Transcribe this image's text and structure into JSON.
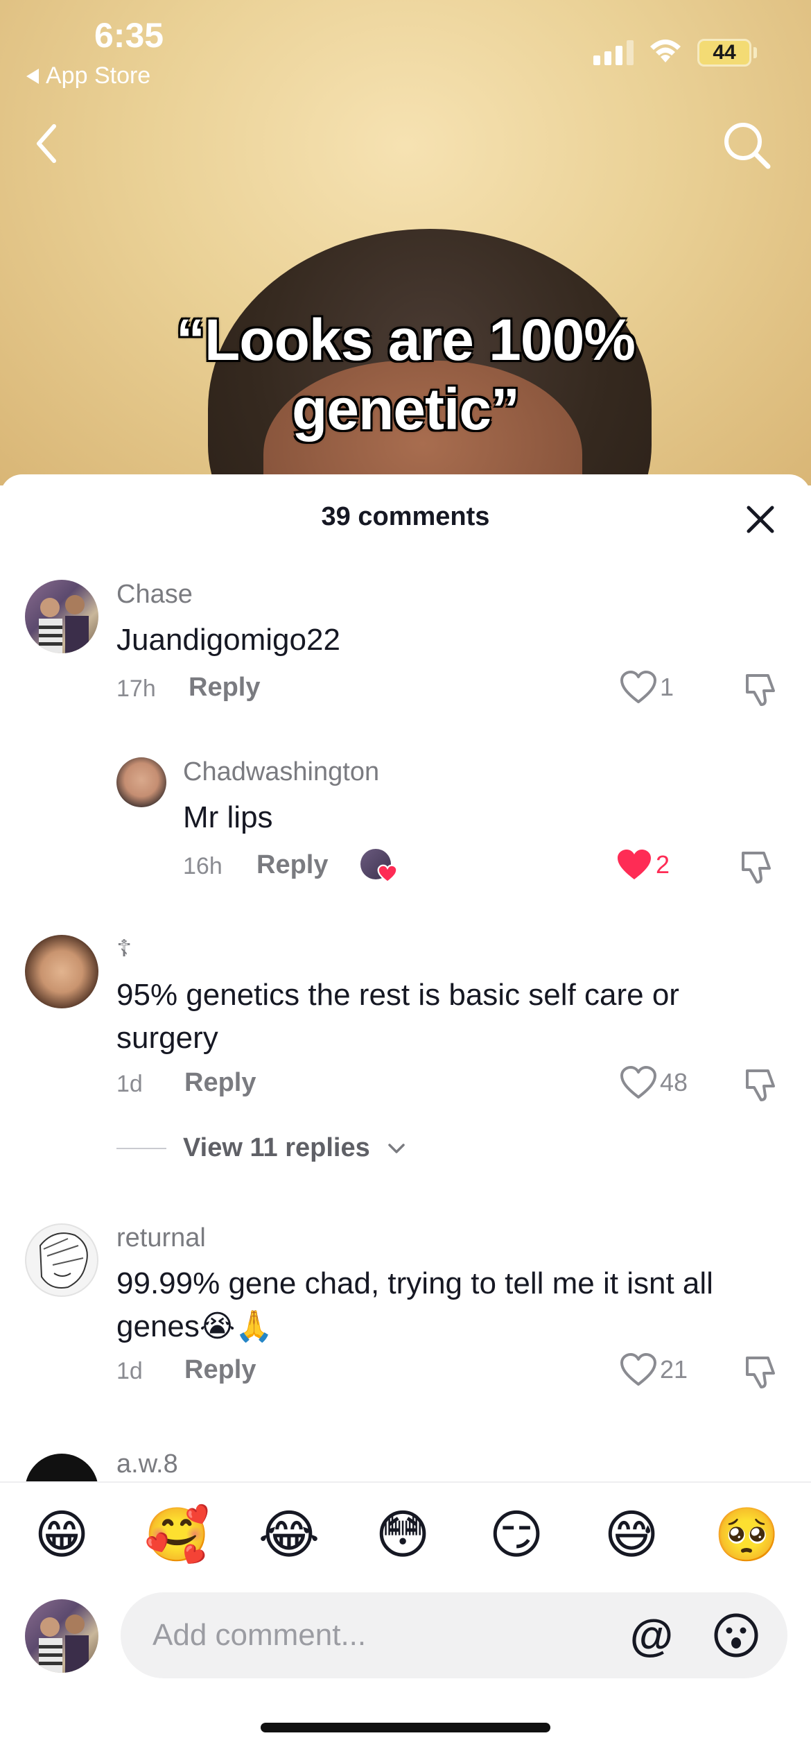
{
  "status_bar": {
    "time": "6:35",
    "back_app": "App Store",
    "battery": "44"
  },
  "video": {
    "caption_line1": "“Looks are 100%",
    "caption_line2": "genetic”"
  },
  "icons": {
    "back": "chevron-left-icon",
    "search": "search-icon",
    "close": "close-icon",
    "like": "heart-icon",
    "dislike": "thumbs-down-icon",
    "mention": "at-icon",
    "emoji": "smiley-icon"
  },
  "colors": {
    "liked": "#fe2c55",
    "muted": "#8a8b91"
  },
  "comments_header": {
    "title": "39 comments"
  },
  "comments": [
    {
      "user": "Chase",
      "text": "Juandigomigo22",
      "time": "17h",
      "reply": "Reply",
      "likes": "1"
    },
    {
      "user": "Chadwashington",
      "text": "Mr lips",
      "time": "16h",
      "reply": "Reply",
      "likes": "2"
    },
    {
      "user": "☦",
      "text_line1": "95% genetics the rest is basic self care or",
      "text_line2": "surgery",
      "time": "1d",
      "reply": "Reply",
      "likes": "48"
    },
    {
      "user": "returnal",
      "text_line1": "99.99% gene chad, trying to tell me it isnt all",
      "text_line2": "genes😭🙏",
      "time": "1d",
      "reply": "Reply",
      "likes": "21"
    },
    {
      "user": "a.w.8"
    }
  ],
  "view_replies": "View 11 replies",
  "emojis": [
    "😁",
    "🥰",
    "😂",
    "😳",
    "😏",
    "😅",
    "🥺"
  ],
  "input": {
    "placeholder": "Add comment...",
    "at": "@"
  }
}
